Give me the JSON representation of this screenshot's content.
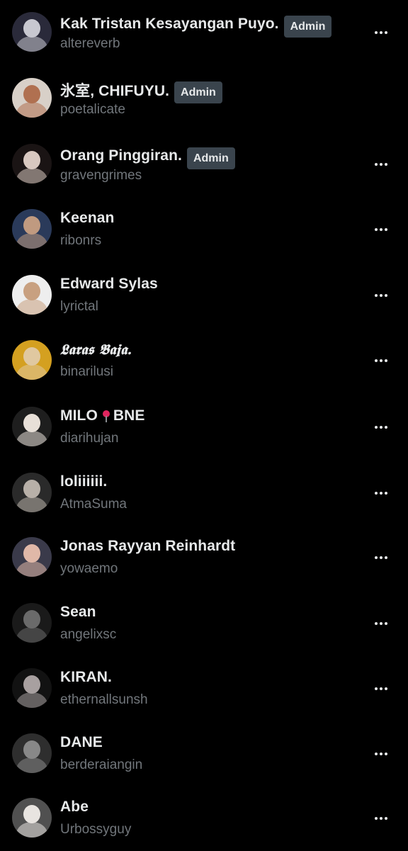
{
  "members": [
    {
      "name": "Kak Tristan Kesayangan Puyo.",
      "handle": "altereverb",
      "badge": "Admin",
      "more": true,
      "avatar_colors": [
        "#c8c8d0",
        "#2a2a3a"
      ]
    },
    {
      "name": "氷室, CHIFUYU.",
      "handle": "poetalicate",
      "badge": "Admin",
      "more": false,
      "avatar_colors": [
        "#b07050",
        "#d8d0c8"
      ]
    },
    {
      "name": "Orang Pinggiran.",
      "handle": "gravengrimes",
      "badge": "Admin",
      "more": true,
      "avatar_colors": [
        "#d8c8c0",
        "#1a1414"
      ]
    },
    {
      "name": "Keenan",
      "handle": "ribonrs",
      "badge": "",
      "more": true,
      "avatar_colors": [
        "#c09a80",
        "#2a3a5a"
      ]
    },
    {
      "name": "Edward Sylas",
      "handle": "lyrictal",
      "badge": "",
      "more": true,
      "avatar_colors": [
        "#c8a080",
        "#eeeeee"
      ]
    },
    {
      "name": "𝕷𝖆𝖗𝖆𝖘 𝕭𝖆𝖏𝖆.",
      "handle": "binarilusi",
      "badge": "",
      "more": true,
      "avatar_colors": [
        "#e0c8a0",
        "#d4a020"
      ]
    },
    {
      "name": "MILO",
      "name_suffix": "BNE",
      "handle": "diarihujan",
      "badge": "",
      "more": true,
      "pin_icon": "round-pushpin-icon",
      "avatar_colors": [
        "#e8e0d8",
        "#1e1e1e"
      ]
    },
    {
      "name": "loliiiiii.",
      "handle": "AtmaSuma",
      "badge": "",
      "more": true,
      "avatar_colors": [
        "#b8b0a8",
        "#2a2a2a"
      ]
    },
    {
      "name": "Jonas Rayyan Reinhardt",
      "handle": "yowaemo",
      "badge": "",
      "more": true,
      "avatar_colors": [
        "#e0b8a8",
        "#3a3a4a"
      ]
    },
    {
      "name": "Sean",
      "handle": "angelixsc",
      "badge": "",
      "more": true,
      "avatar_colors": [
        "#6a6a6a",
        "#1a1a1a"
      ]
    },
    {
      "name": "KIRAN.",
      "handle": "ethernallsunsh",
      "badge": "",
      "more": true,
      "avatar_colors": [
        "#a8a0a0",
        "#121212"
      ]
    },
    {
      "name": "DANE",
      "handle": "berderaiangin",
      "badge": "",
      "more": true,
      "avatar_colors": [
        "#888888",
        "#2e2e2e"
      ]
    },
    {
      "name": "Abe",
      "handle": "Urbossyguy",
      "badge": "",
      "more": true,
      "avatar_colors": [
        "#e8e4e0",
        "#505050"
      ]
    }
  ]
}
